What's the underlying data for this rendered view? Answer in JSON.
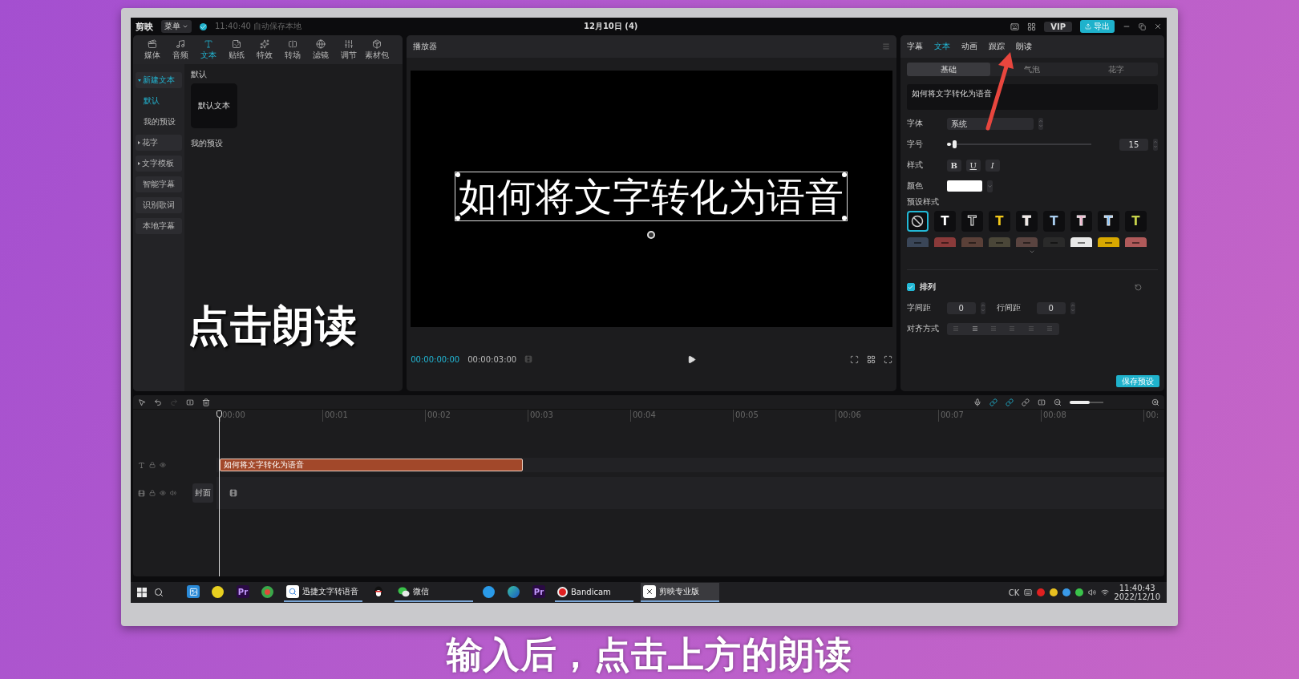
{
  "title_bar": {
    "app_name": "剪映",
    "menu": "菜单",
    "autosave": "11:40:40 自动保存本地",
    "project": "12月10日 (4)",
    "vip": "VIP",
    "export": "导出"
  },
  "media_tabs": [
    {
      "label": "媒体",
      "kind": "media",
      "selected": false
    },
    {
      "label": "音频",
      "kind": "audio",
      "selected": false
    },
    {
      "label": "文本",
      "kind": "text",
      "selected": true
    },
    {
      "label": "贴纸",
      "kind": "sticker",
      "selected": false
    },
    {
      "label": "特效",
      "kind": "effect",
      "selected": false
    },
    {
      "label": "转场",
      "kind": "transition",
      "selected": false
    },
    {
      "label": "滤镜",
      "kind": "filter",
      "selected": false
    },
    {
      "label": "调节",
      "kind": "adjust",
      "selected": false
    },
    {
      "label": "素材包",
      "kind": "pack",
      "selected": false
    }
  ],
  "text_sidebar": [
    {
      "label": "新建文本",
      "kind": "group",
      "expanded": true,
      "selected": true,
      "children": [
        {
          "label": "默认",
          "selected": true
        },
        {
          "label": "我的预设",
          "selected": false
        }
      ]
    },
    {
      "label": "花字",
      "kind": "group",
      "expanded": false,
      "selected": false
    },
    {
      "label": "文字模板",
      "kind": "group",
      "expanded": false,
      "selected": false
    },
    {
      "label": "智能字幕",
      "kind": "item",
      "selected": false
    },
    {
      "label": "识别歌词",
      "kind": "item",
      "selected": false
    },
    {
      "label": "本地字幕",
      "kind": "item",
      "selected": false
    }
  ],
  "library": {
    "default_heading": "默认",
    "default_card": "默认文本",
    "presets_heading": "我的预设"
  },
  "overlay_caption": "点击朗读",
  "player": {
    "title": "播放器",
    "caption": "如何将文字转化为语音",
    "current_time": "00:00:00:00",
    "duration": "00:00:03:00"
  },
  "inspector": {
    "tabs": [
      {
        "label": "字幕",
        "selected": false
      },
      {
        "label": "文本",
        "selected": true
      },
      {
        "label": "动画",
        "selected": false
      },
      {
        "label": "跟踪",
        "selected": false
      },
      {
        "label": "朗读",
        "selected": false
      }
    ],
    "subtabs": [
      {
        "label": "基础",
        "selected": true
      },
      {
        "label": "气泡",
        "selected": false
      },
      {
        "label": "花字",
        "selected": false
      }
    ],
    "text_value": "如何将文字转化为语音",
    "font_label": "字体",
    "font": "系统",
    "size_label": "字号",
    "size_slider": {
      "level": 0.03
    },
    "size_value": "15",
    "style_label": "样式",
    "style_buttons": [
      {
        "label": "B",
        "kind": "bold"
      },
      {
        "label": "U",
        "kind": "underline"
      },
      {
        "label": "I",
        "kind": "italic"
      }
    ],
    "color_label": "颜色",
    "preset_label": "预设样式",
    "presets": [
      {
        "kind": "none",
        "selected": true
      },
      {
        "kind": "glyph",
        "glyph": "T",
        "color": "#ffffff",
        "outline": false,
        "selected": false
      },
      {
        "kind": "glyph",
        "glyph": "T",
        "color": "#111111",
        "outline": true,
        "selected": false
      },
      {
        "kind": "glyph",
        "glyph": "T",
        "color": "#f2c81a",
        "outline": false,
        "selected": false
      },
      {
        "kind": "glyph",
        "glyph": "T",
        "color": "#f4e6e0",
        "outline": true,
        "selected": false
      },
      {
        "kind": "glyph",
        "glyph": "T",
        "color": "#a9cdee",
        "outline": false,
        "selected": false
      },
      {
        "kind": "glyph",
        "glyph": "T",
        "color": "#f3a6c6",
        "outline": true,
        "selected": false
      },
      {
        "kind": "glyph",
        "glyph": "T",
        "color": "#7fc2ff",
        "outline": true,
        "selected": false
      },
      {
        "kind": "glyph",
        "glyph": "T",
        "color": "#c5d24a",
        "outline": false,
        "selected": false
      }
    ],
    "preset_row_two": [
      {
        "color": "#3a4658"
      },
      {
        "color": "#8a3a3a"
      },
      {
        "color": "#5a4038"
      },
      {
        "color": "#4a4638"
      },
      {
        "color": "#5a4440"
      },
      {
        "color": "#2a2a2a"
      },
      {
        "color": "#e8e8e8"
      },
      {
        "color": "#d8a800"
      },
      {
        "color": "#b05a5a"
      }
    ],
    "arrange": {
      "label": "排列",
      "checked": true
    },
    "letter_spacing_label": "字间距",
    "letter_spacing": "0",
    "line_spacing_label": "行间距",
    "line_spacing": "0",
    "align_label": "对齐方式",
    "save_preset": "保存预设"
  },
  "timeline": {
    "zoom": {
      "level": 0.6
    },
    "ticks": [
      "00:00",
      "00:01",
      "00:02",
      "00:03",
      "00:04",
      "00:05",
      "00:06",
      "00:07",
      "00:08",
      "00:"
    ],
    "text_clip": "如何将文字转化为语音",
    "cover": "封面"
  },
  "taskbar": {
    "items": [
      {
        "kind": "photos",
        "open": false,
        "selected": false
      },
      {
        "kind": "music",
        "open": false,
        "selected": false
      },
      {
        "kind": "premiere",
        "label": "Pr",
        "open": false,
        "selected": false
      },
      {
        "kind": "chrome",
        "open": false,
        "selected": false
      },
      {
        "kind": "tts",
        "label": "迅捷文字转语音",
        "open": true,
        "selected": false
      },
      {
        "kind": "qq",
        "open": false,
        "selected": false
      },
      {
        "kind": "wechat",
        "label": "微信",
        "open": true,
        "selected": false
      },
      {
        "kind": "ie",
        "open": false,
        "selected": false
      },
      {
        "kind": "edge",
        "open": false,
        "selected": false
      },
      {
        "kind": "premiere",
        "label": "Pr",
        "open": false,
        "selected": false
      },
      {
        "kind": "record",
        "label": "Bandicam",
        "open": true,
        "selected": false
      },
      {
        "kind": "capcut",
        "label": "剪映专业版",
        "open": true,
        "selected": true
      }
    ],
    "ime": "CK",
    "time": "11:40:43",
    "date": "2022/12/10"
  },
  "subtitle": "输入后，点击上方的朗读"
}
